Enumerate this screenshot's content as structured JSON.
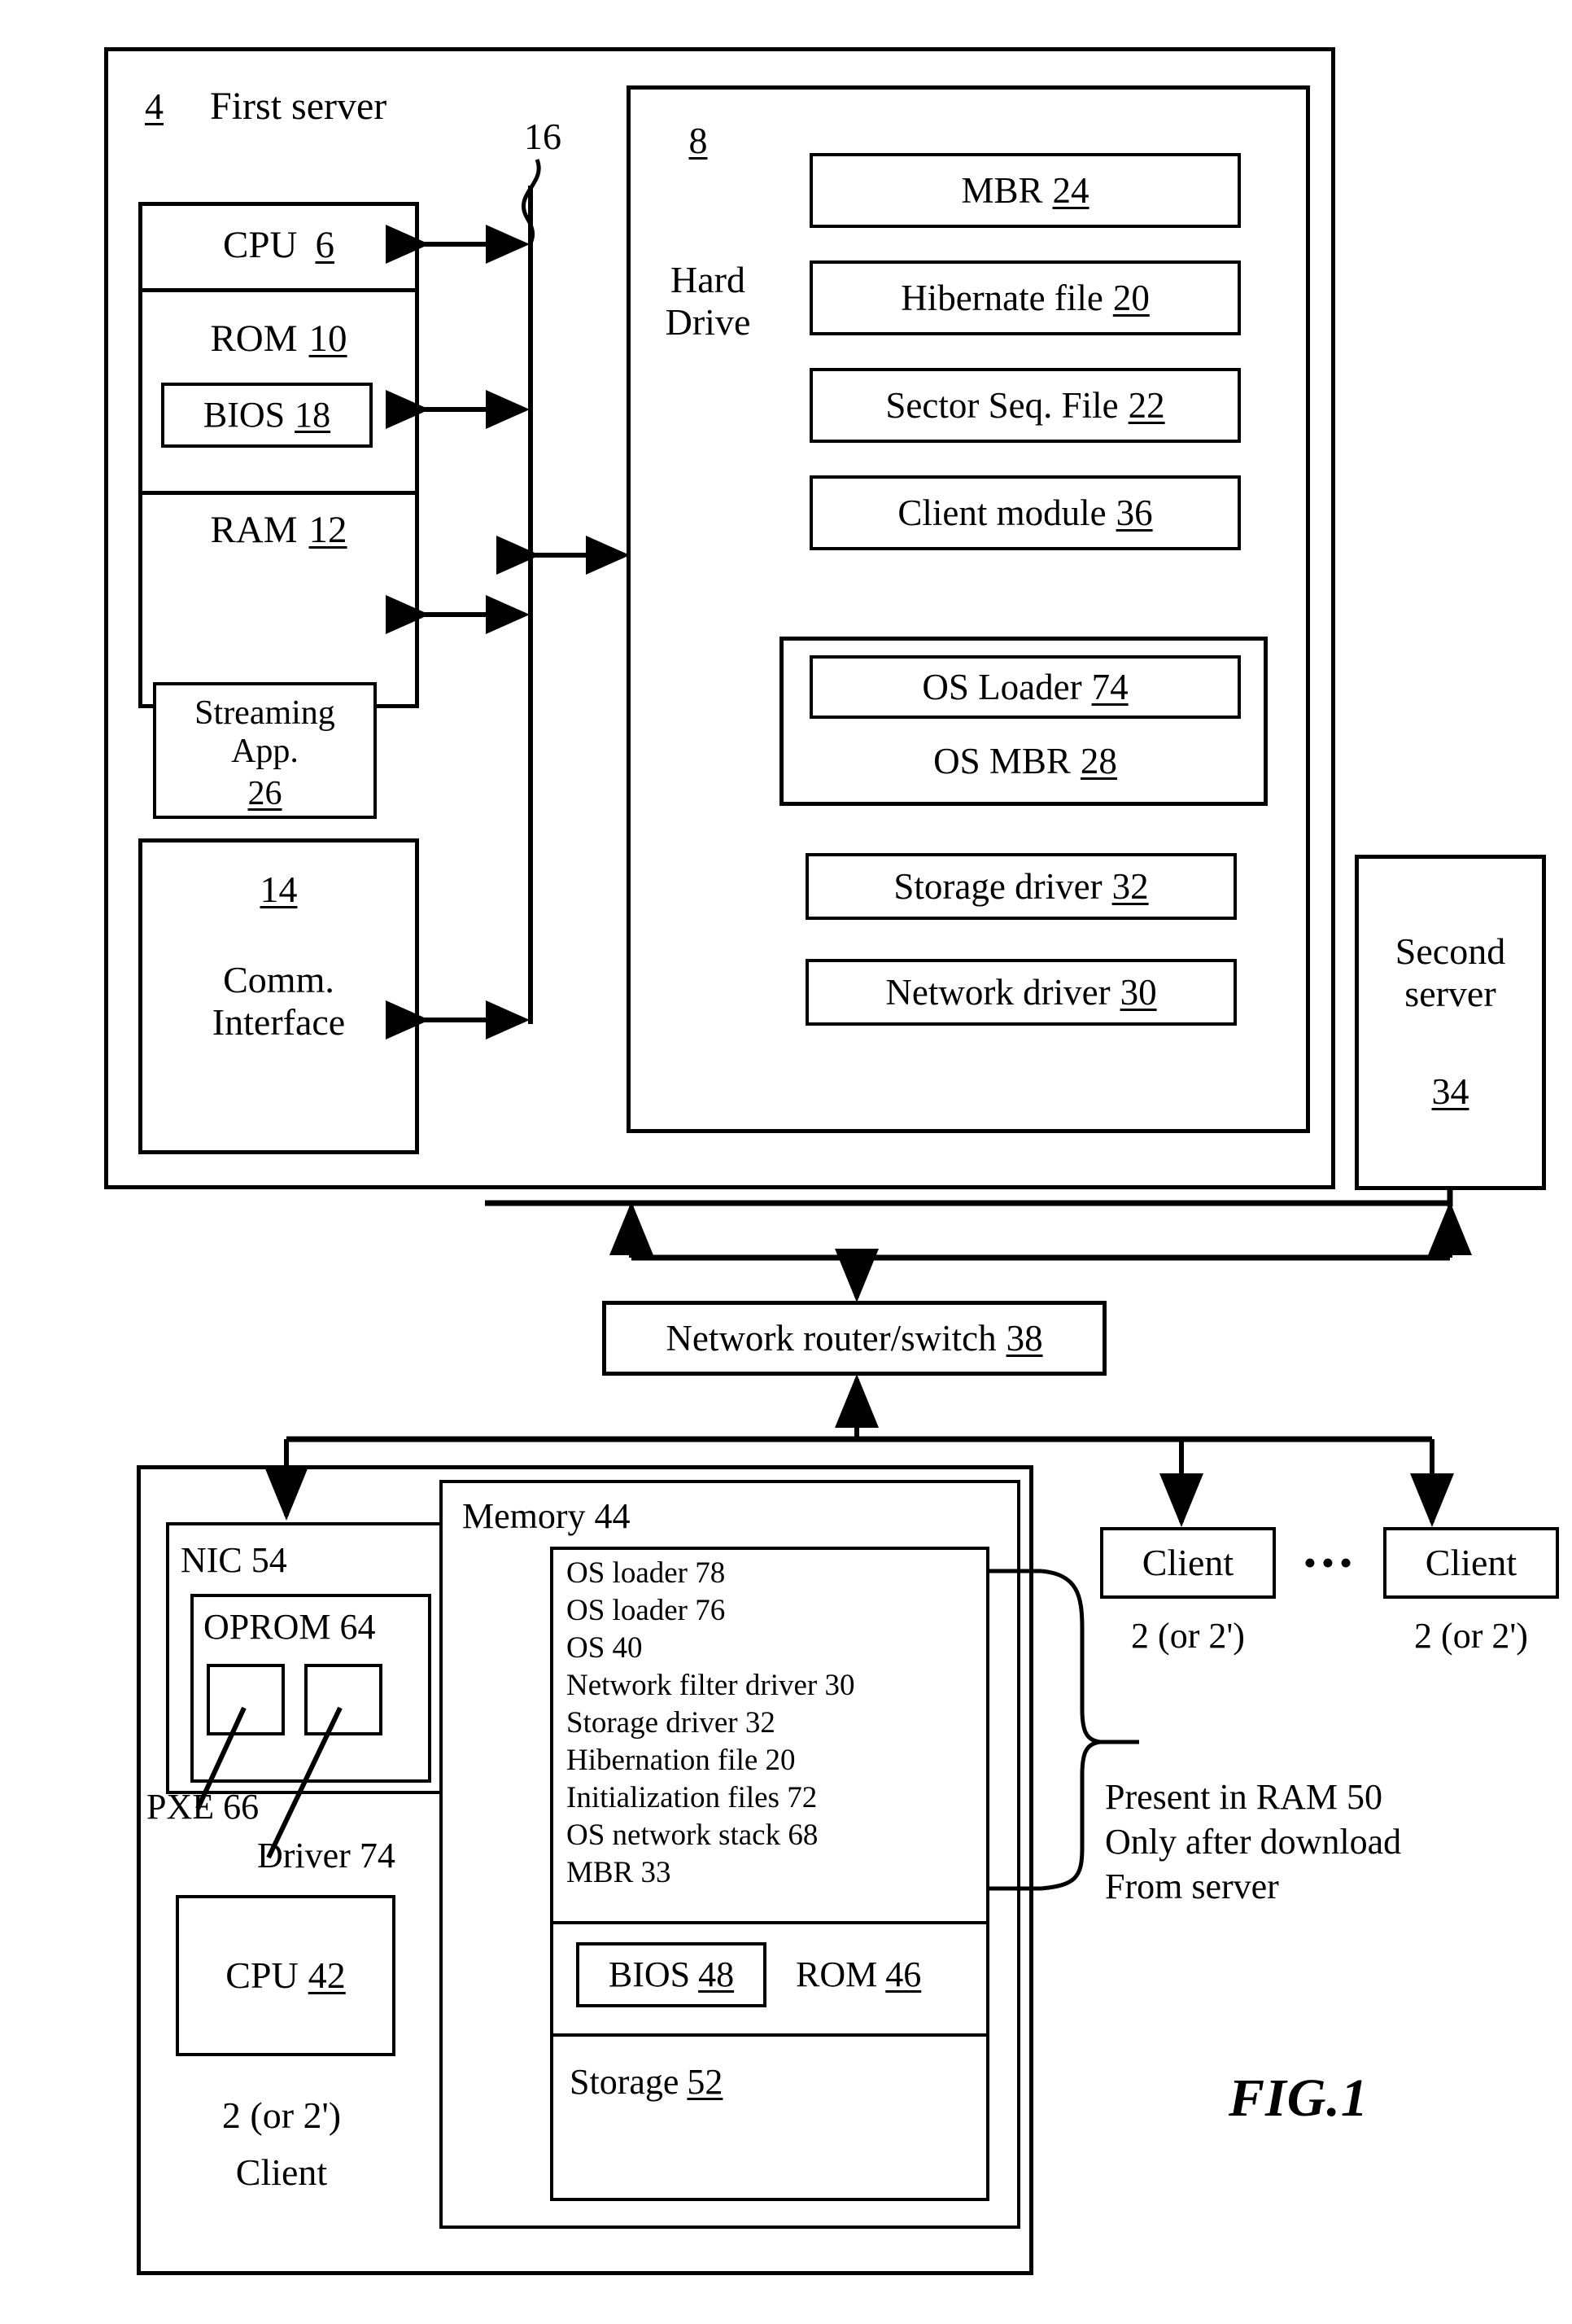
{
  "figure": {
    "caption": "FIG.1"
  },
  "first_server": {
    "ref": "4",
    "title": "First  server",
    "bus_ref": "16",
    "cpu": {
      "label": "CPU",
      "ref": "6"
    },
    "rom": {
      "label": "ROM",
      "ref": "10"
    },
    "bios": {
      "label": "BIOS",
      "ref": "18"
    },
    "ram": {
      "label": "RAM",
      "ref": "12"
    },
    "streaming_app": {
      "label": "Streaming\nApp.",
      "ref": "26"
    },
    "comm_interface": {
      "ref": "14",
      "label": "Comm.\nInterface"
    }
  },
  "hard_drive": {
    "ref": "8",
    "label": "Hard\nDrive",
    "items": [
      {
        "label": "MBR",
        "ref": "24"
      },
      {
        "label": "Hibernate file",
        "ref": "20"
      },
      {
        "label": "Sector Seq. File",
        "ref": "22"
      },
      {
        "label": "Client module",
        "ref": "36"
      }
    ],
    "os_group": [
      {
        "label": "OS Loader",
        "ref": "74"
      },
      {
        "label": "OS MBR",
        "ref": "28"
      }
    ],
    "drivers": [
      {
        "label": "Storage driver",
        "ref": "32"
      },
      {
        "label": "Network driver",
        "ref": "30"
      }
    ]
  },
  "second_server": {
    "label": "Second\nserver",
    "ref": "34"
  },
  "network": {
    "router": {
      "label": "Network router/switch",
      "ref": "38"
    }
  },
  "client_detail": {
    "nic": {
      "label": "NIC 54"
    },
    "oprom": {
      "label": "OPROM 64"
    },
    "pxe_callout": "PXE 66",
    "driver_callout": "Driver 74",
    "cpu": {
      "label": "CPU",
      "ref": "42"
    },
    "client_caption_ref": "2 (or 2')",
    "client_caption": "Client",
    "memory": {
      "label": "Memory 44",
      "items": [
        "OS loader 78",
        "OS loader 76",
        "OS 40",
        "Network filter driver 30",
        "Storage driver 32",
        "Hibernation file 20",
        "Initialization files 72",
        "OS network stack 68",
        "MBR 33"
      ],
      "bios": {
        "label": "BIOS",
        "ref": "48"
      },
      "rom": {
        "label": "ROM",
        "ref": "46"
      },
      "storage": {
        "label": "Storage",
        "ref": "52"
      }
    }
  },
  "clients": [
    {
      "label": "Client",
      "ref": "2 (or 2')"
    },
    {
      "label": "Client",
      "ref": "2 (or 2')"
    }
  ],
  "clients_ellipsis": "•••",
  "ram_note": "Present in RAM 50\nOnly after download\nFrom server",
  "colors": {
    "ink": "#000000",
    "paper": "#ffffff"
  }
}
